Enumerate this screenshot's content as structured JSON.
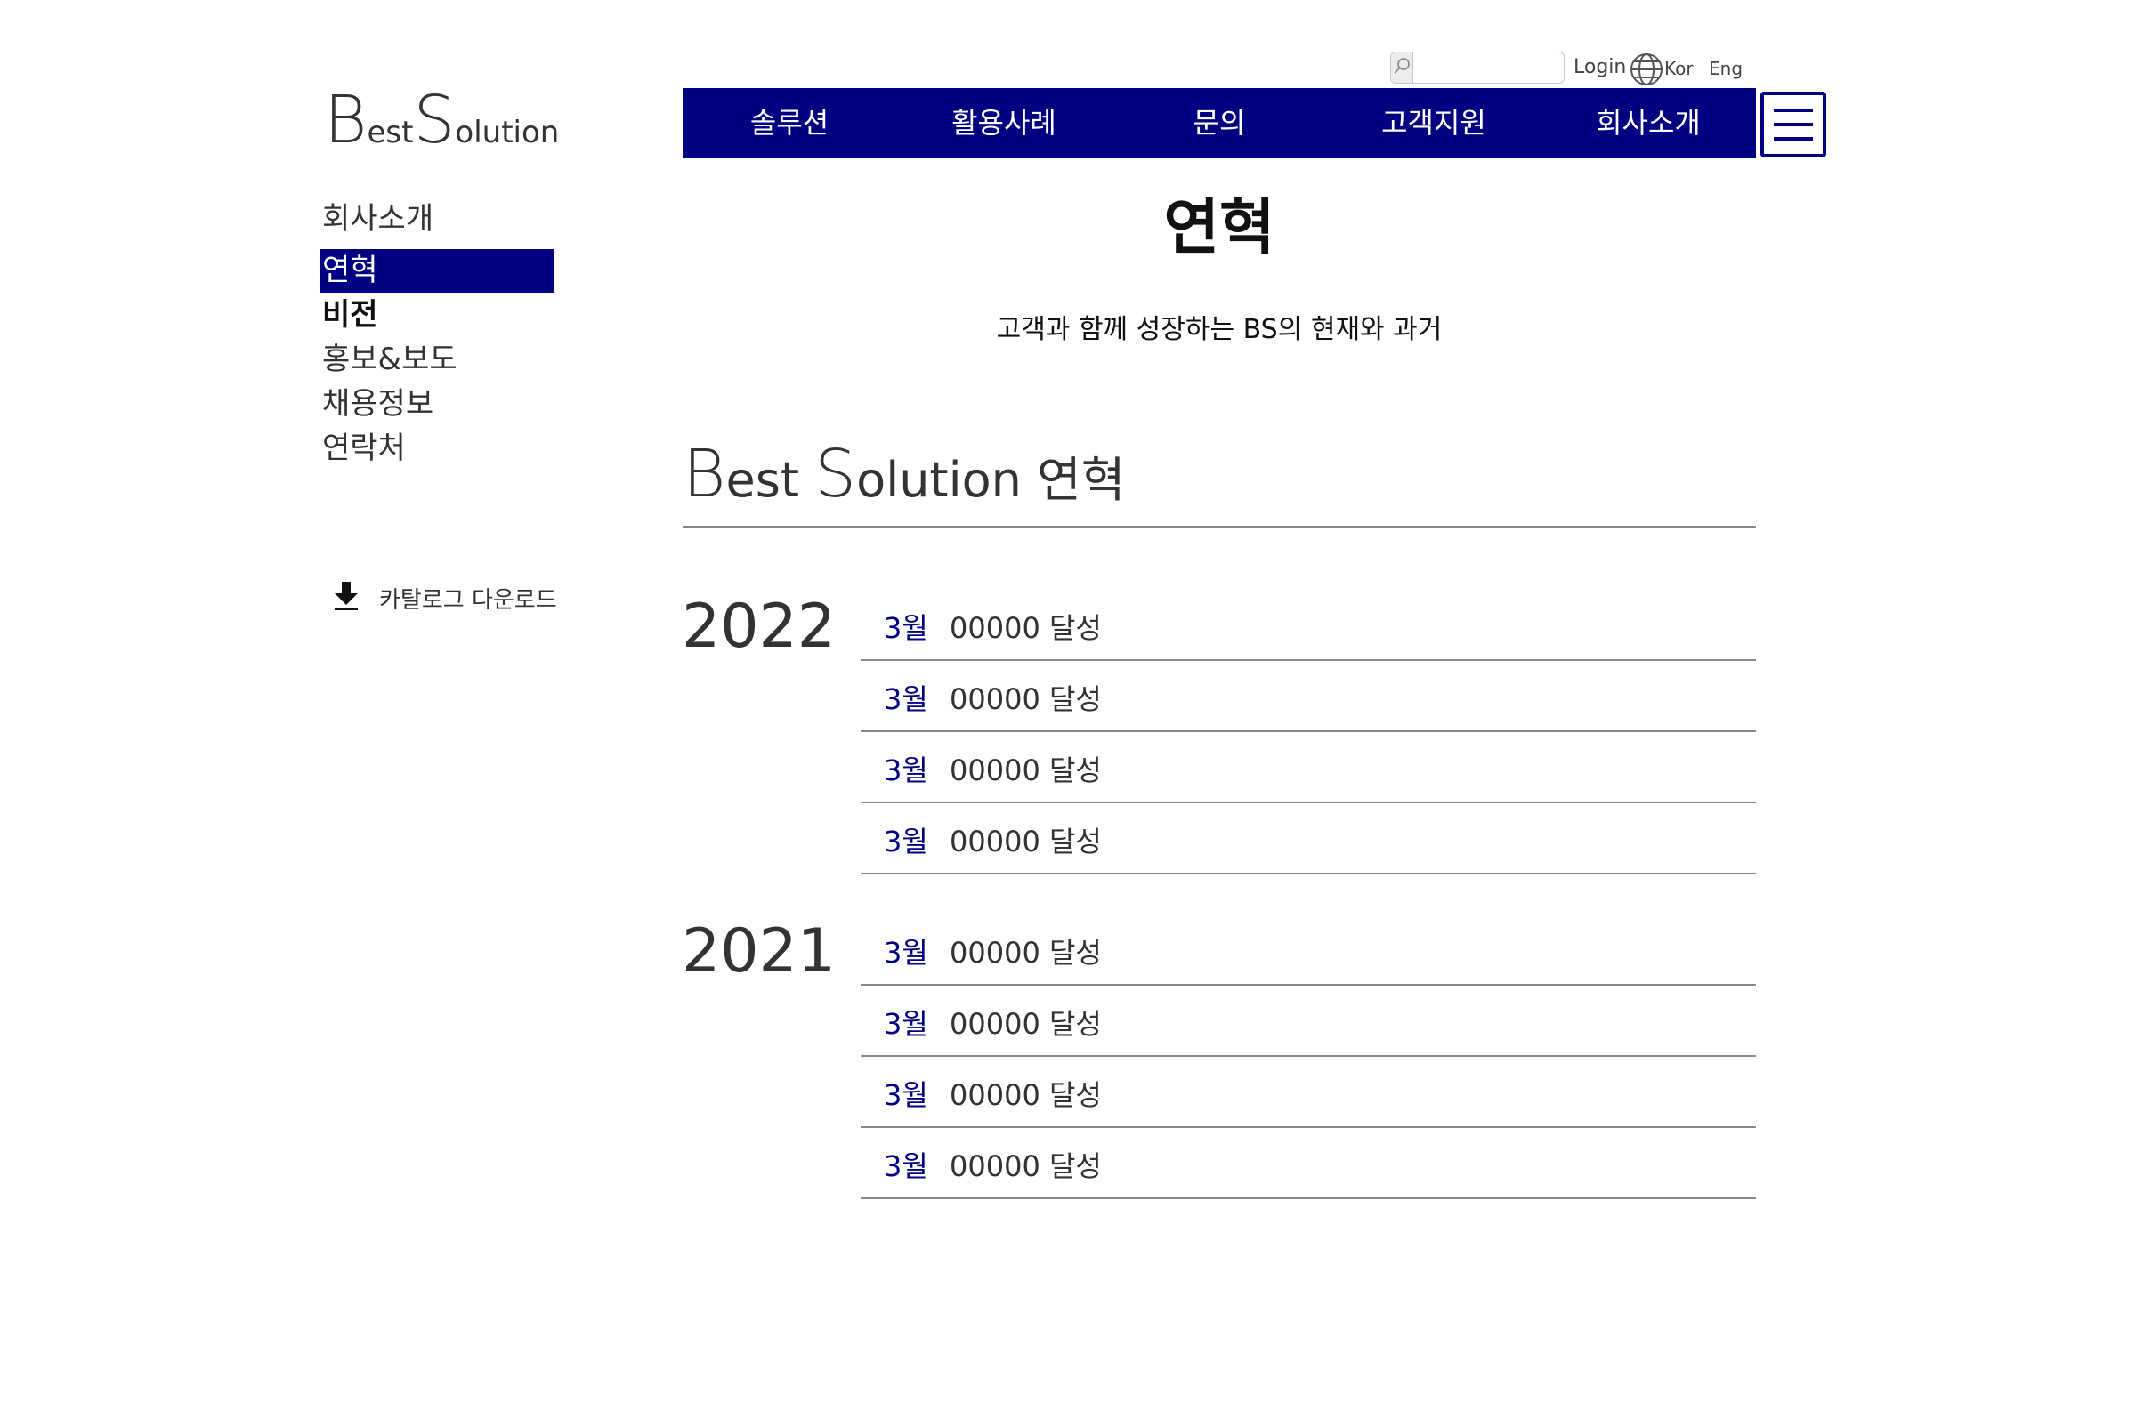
{
  "topbar": {
    "search_placeholder": "",
    "login": "Login",
    "lang_kor": "Kor",
    "lang_eng": "Eng"
  },
  "logo": {
    "b": "B",
    "est": "est",
    "s": "S",
    "olution": "olution"
  },
  "nav": {
    "items": [
      "솔루션",
      "활용사례",
      "문의",
      "고객지원",
      "회사소개"
    ]
  },
  "sidebar": {
    "title": "회사소개",
    "items": [
      {
        "label": "연혁"
      },
      {
        "label": "비전"
      },
      {
        "label": "홍보&보도"
      },
      {
        "label": "채용정보"
      },
      {
        "label": "연락처"
      }
    ],
    "catalog": "카탈로그 다운로드"
  },
  "page": {
    "title": "연혁",
    "subtitle": "고객과 함께 성장하는 BS의 현재와 과거"
  },
  "section": {
    "b": "B",
    "est": "est ",
    "s": "S",
    "olution": "olution ",
    "kr": "연혁"
  },
  "history": [
    {
      "year": "2022",
      "events": [
        {
          "month": "3월",
          "desc": "00000 달성"
        },
        {
          "month": "3월",
          "desc": "00000 달성"
        },
        {
          "month": "3월",
          "desc": "00000 달성"
        },
        {
          "month": "3월",
          "desc": "00000 달성"
        }
      ]
    },
    {
      "year": "2021",
      "events": [
        {
          "month": "3월",
          "desc": "00000 달성"
        },
        {
          "month": "3월",
          "desc": "00000 달성"
        },
        {
          "month": "3월",
          "desc": "00000 달성"
        },
        {
          "month": "3월",
          "desc": "00000 달성"
        }
      ]
    }
  ],
  "colors": {
    "brand": "#000080",
    "text": "#333333",
    "rule": "#888888"
  }
}
